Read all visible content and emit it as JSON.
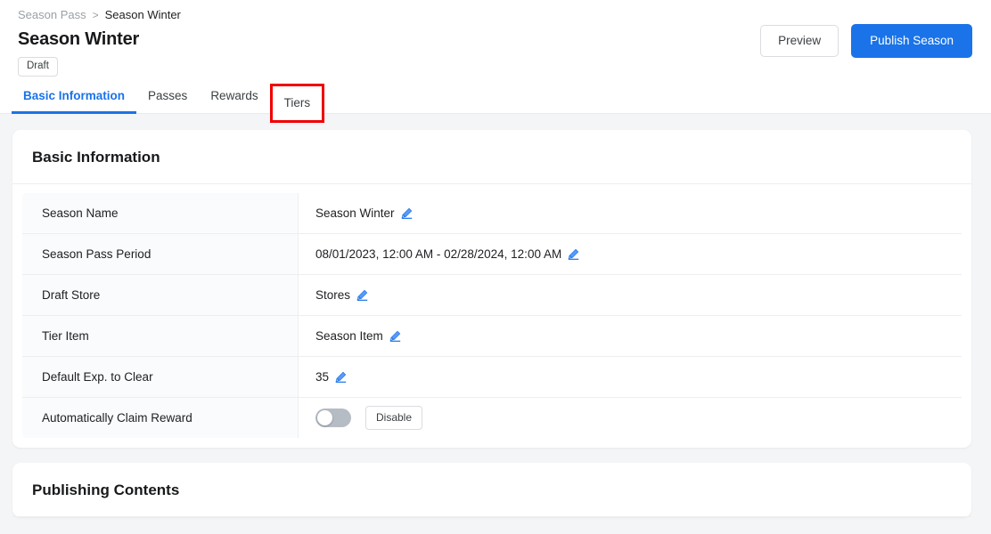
{
  "breadcrumb": {
    "parent": "Season Pass",
    "separator": ">",
    "current": "Season Winter"
  },
  "header": {
    "title": "Season Winter",
    "status": "Draft",
    "preview_label": "Preview",
    "publish_label": "Publish Season",
    "accent_color": "#1a73e8",
    "highlight_color": "#f00000"
  },
  "tabs": [
    {
      "label": "Basic Information",
      "active": true,
      "highlighted": false
    },
    {
      "label": "Passes",
      "active": false,
      "highlighted": false
    },
    {
      "label": "Rewards",
      "active": false,
      "highlighted": false
    },
    {
      "label": "Tiers",
      "active": false,
      "highlighted": true
    }
  ],
  "basic_information": {
    "card_title": "Basic Information",
    "rows": [
      {
        "label": "Season Name",
        "value": "Season Winter",
        "control": "edit",
        "icon": "pencil-icon"
      },
      {
        "label": "Season Pass Period",
        "value": "08/01/2023, 12:00 AM - 02/28/2024, 12:00 AM",
        "control": "edit",
        "icon": "pencil-icon"
      },
      {
        "label": "Draft Store",
        "value": "Stores",
        "control": "edit",
        "icon": "pencil-icon"
      },
      {
        "label": "Tier Item",
        "value": "Season Item",
        "control": "edit",
        "icon": "pencil-icon"
      },
      {
        "label": "Default Exp. to Clear",
        "value": "35",
        "control": "edit",
        "icon": "pencil-icon"
      },
      {
        "label": "Automatically Claim Reward",
        "value": "",
        "control": "toggle",
        "toggle_state": "off",
        "button_label": "Disable"
      }
    ]
  },
  "publishing_contents": {
    "card_title": "Publishing Contents"
  }
}
